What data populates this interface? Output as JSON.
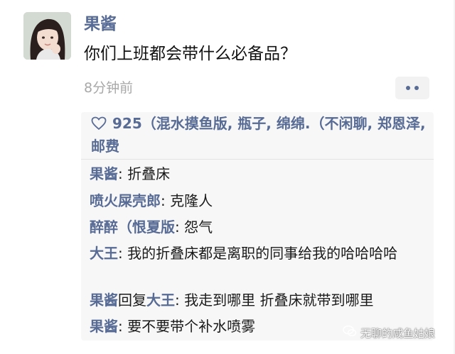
{
  "post": {
    "author": "果酱",
    "text": "你们上班都会带什么必备品？",
    "time": "8分钟前"
  },
  "icons": {
    "more": "more-dots-icon",
    "like": "heart-outline-icon",
    "watermark": "wechat-logo-icon"
  },
  "likes": {
    "count": "925",
    "names": "（混水摸鱼版, 瓶子, 绵绵.（不闲聊, 郑恩泽, 邮费"
  },
  "comments": [
    {
      "author": "果酱",
      "text": ": 折叠床"
    },
    {
      "author": "喷火屎壳郎",
      "text": ": 克隆人"
    },
    {
      "author": "醉醉（恨夏版",
      "text": ": 怨气"
    },
    {
      "author": "大王",
      "text": ": 我的折叠床都是离职的同事给我的哈哈哈哈"
    },
    {
      "author": "果酱",
      "reply_word": "回复",
      "reply_to": "大王",
      "text": ": 我走到哪里 折叠床就带到哪里"
    },
    {
      "author": "果酱",
      "text": ": 要不要带个补水喷雾"
    }
  ],
  "watermark": "无聊的咸鱼姑娘",
  "colors": {
    "name": "#576b95",
    "time": "#a8a8a8",
    "card": "#f7f7f7"
  }
}
